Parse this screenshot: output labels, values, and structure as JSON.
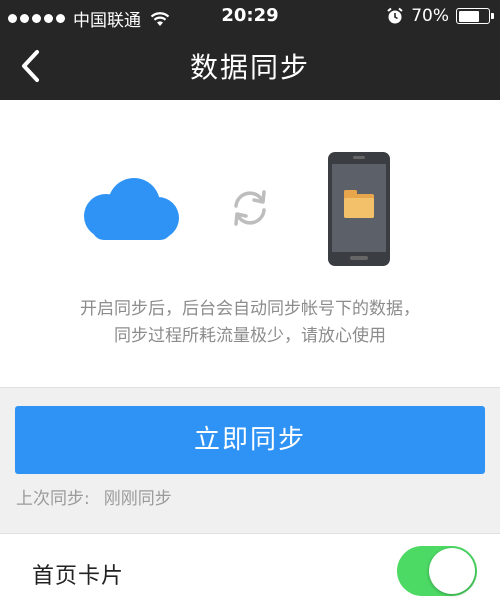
{
  "status_bar": {
    "carrier": "中国联通",
    "time": "20:29",
    "battery_percent": "70%",
    "battery_level": 0.7,
    "icons": [
      "signal-dots-icon",
      "wifi-icon",
      "alarm-clock-icon",
      "battery-icon"
    ]
  },
  "nav": {
    "title": "数据同步",
    "back_icon": "chevron-left-icon"
  },
  "hero": {
    "icons": [
      "cloud-icon",
      "sync-arrows-icon",
      "phone-folder-icon"
    ],
    "description_line1": "开启同步后，后台会自动同步帐号下的数据，",
    "description_line2": "同步过程所耗流量极少，请放心使用"
  },
  "actions": {
    "sync_button_label": "立即同步",
    "last_sync_label": "上次同步:",
    "last_sync_value": "刚刚同步"
  },
  "settings": {
    "home_card_label": "首页卡片",
    "home_card_enabled": true
  },
  "colors": {
    "header_bg": "#262626",
    "accent_blue": "#2f93f6",
    "toggle_on": "#4cd964",
    "page_bg": "#f0f0f0"
  }
}
